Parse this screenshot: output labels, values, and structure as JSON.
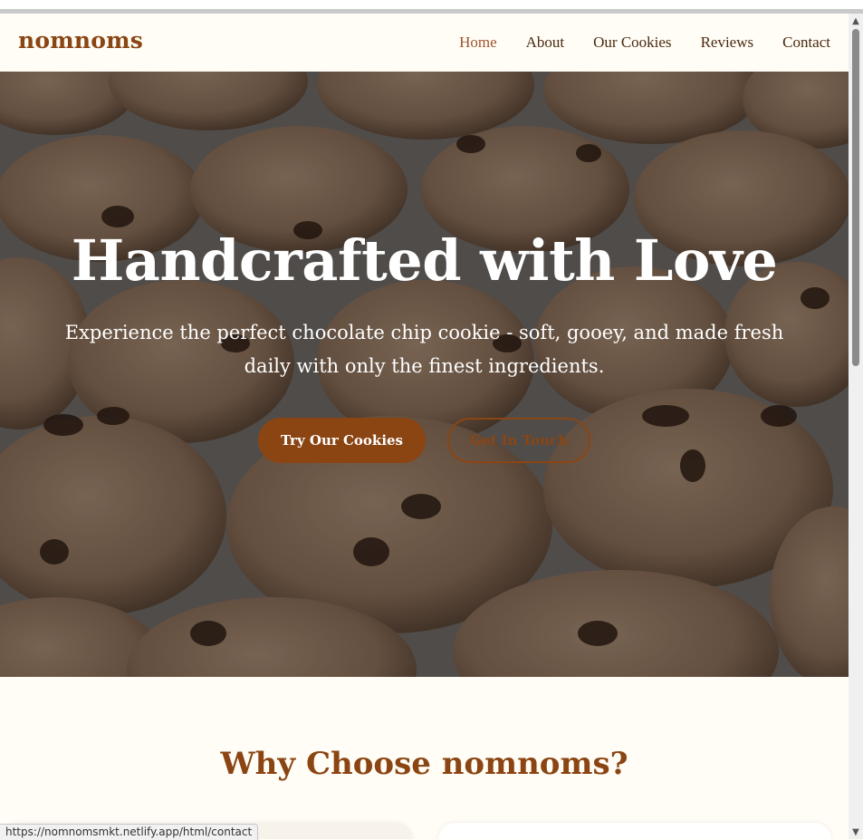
{
  "site": {
    "brand": "nomnoms",
    "nav": [
      {
        "label": "Home",
        "active": true
      },
      {
        "label": "About",
        "active": false
      },
      {
        "label": "Our Cookies",
        "active": false
      },
      {
        "label": "Reviews",
        "active": false
      },
      {
        "label": "Contact",
        "active": false
      }
    ]
  },
  "hero": {
    "title": "Handcrafted with Love",
    "subtitle": "Experience the perfect chocolate chip cookie - soft, gooey, and made fresh daily with only the finest ingredients.",
    "primary_button": "Try Our Cookies",
    "secondary_button": "Get In Touch"
  },
  "why": {
    "title": "Why Choose nomnoms?"
  },
  "status_bar": {
    "url": "https://nomnomsmkt.netlify.app/html/contact"
  },
  "colors": {
    "brand": "#8b4513",
    "background": "#fffdf5",
    "nav_text": "#4a2a12",
    "nav_active": "#a0522d"
  },
  "icons": {
    "scroll_up": "triangle-up-icon",
    "scroll_down": "triangle-down-icon"
  }
}
